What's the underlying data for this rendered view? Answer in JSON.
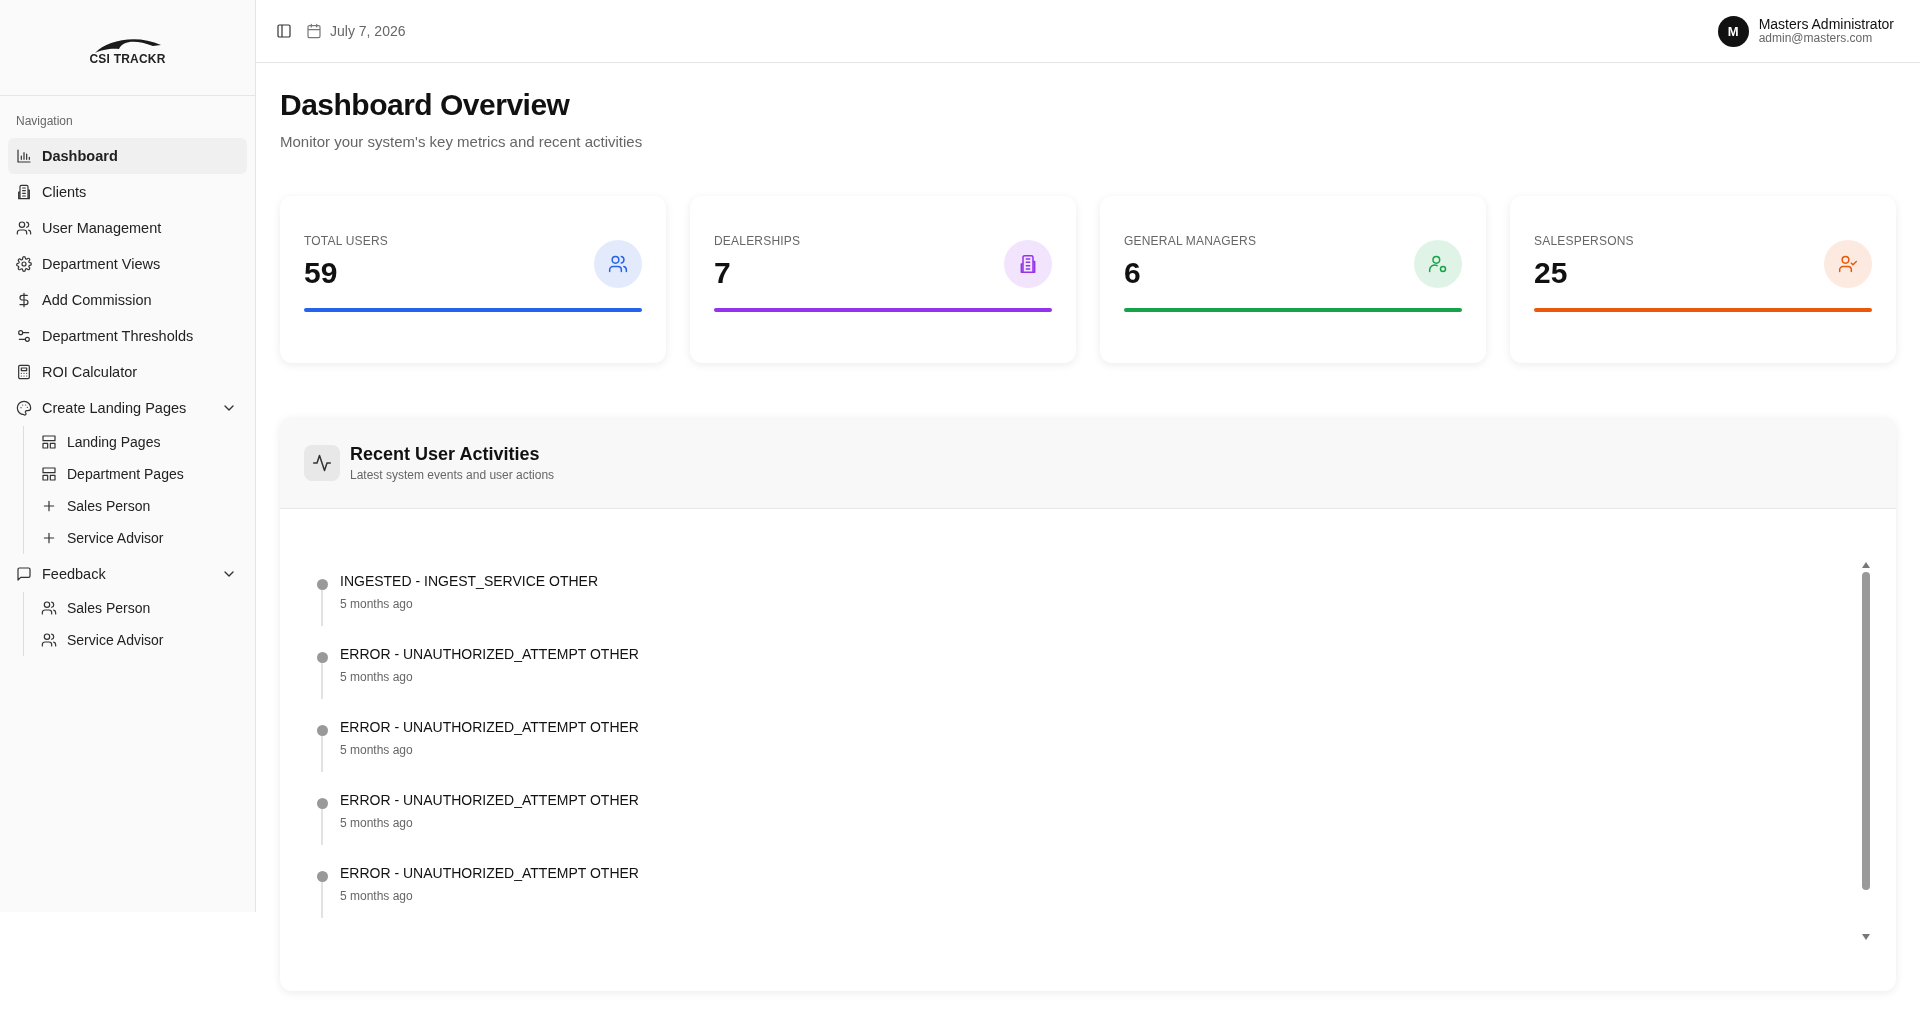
{
  "logo": {
    "text": "CSI TRACKR"
  },
  "sidebar": {
    "section_label": "Navigation",
    "items": [
      {
        "label": "Dashboard",
        "selected": true
      },
      {
        "label": "Clients",
        "selected": false
      },
      {
        "label": "User Management",
        "selected": false
      },
      {
        "label": "Department Views",
        "selected": false
      },
      {
        "label": "Add Commission",
        "selected": false
      },
      {
        "label": "Department Thresholds",
        "selected": false
      },
      {
        "label": "ROI Calculator",
        "selected": false
      },
      {
        "label": "Create Landing Pages",
        "selected": false,
        "expanded": true,
        "children": [
          {
            "label": "Landing Pages"
          },
          {
            "label": "Department Pages"
          },
          {
            "label": "Sales Person"
          },
          {
            "label": "Service Advisor"
          }
        ]
      },
      {
        "label": "Feedback",
        "selected": false,
        "expanded": true,
        "children": [
          {
            "label": "Sales Person"
          },
          {
            "label": "Service Advisor"
          }
        ]
      }
    ]
  },
  "header": {
    "date": "July 7, 2026",
    "user": {
      "initial": "M",
      "name": "Masters Administrator",
      "email": "admin@masters.com"
    }
  },
  "page": {
    "title": "Dashboard Overview",
    "subtitle": "Monitor your system's key metrics and recent activities"
  },
  "stats": [
    {
      "label": "TOTAL USERS",
      "value": "59",
      "color": "#2563eb"
    },
    {
      "label": "DEALERSHIPS",
      "value": "7",
      "color": "#9333ea"
    },
    {
      "label": "GENERAL MANAGERS",
      "value": "6",
      "color": "#16a34a"
    },
    {
      "label": "SALESPERSONS",
      "value": "25",
      "color": "#ea580c"
    }
  ],
  "activities": {
    "title": "Recent User Activities",
    "subtitle": "Latest system events and user actions",
    "items": [
      {
        "title": "INGESTED - INGEST_SERVICE OTHER",
        "time": "5 months ago"
      },
      {
        "title": "ERROR - UNAUTHORIZED_ATTEMPT OTHER",
        "time": "5 months ago"
      },
      {
        "title": "ERROR - UNAUTHORIZED_ATTEMPT OTHER",
        "time": "5 months ago"
      },
      {
        "title": "ERROR - UNAUTHORIZED_ATTEMPT OTHER",
        "time": "5 months ago"
      },
      {
        "title": "ERROR - UNAUTHORIZED_ATTEMPT OTHER",
        "time": "5 months ago"
      }
    ]
  }
}
